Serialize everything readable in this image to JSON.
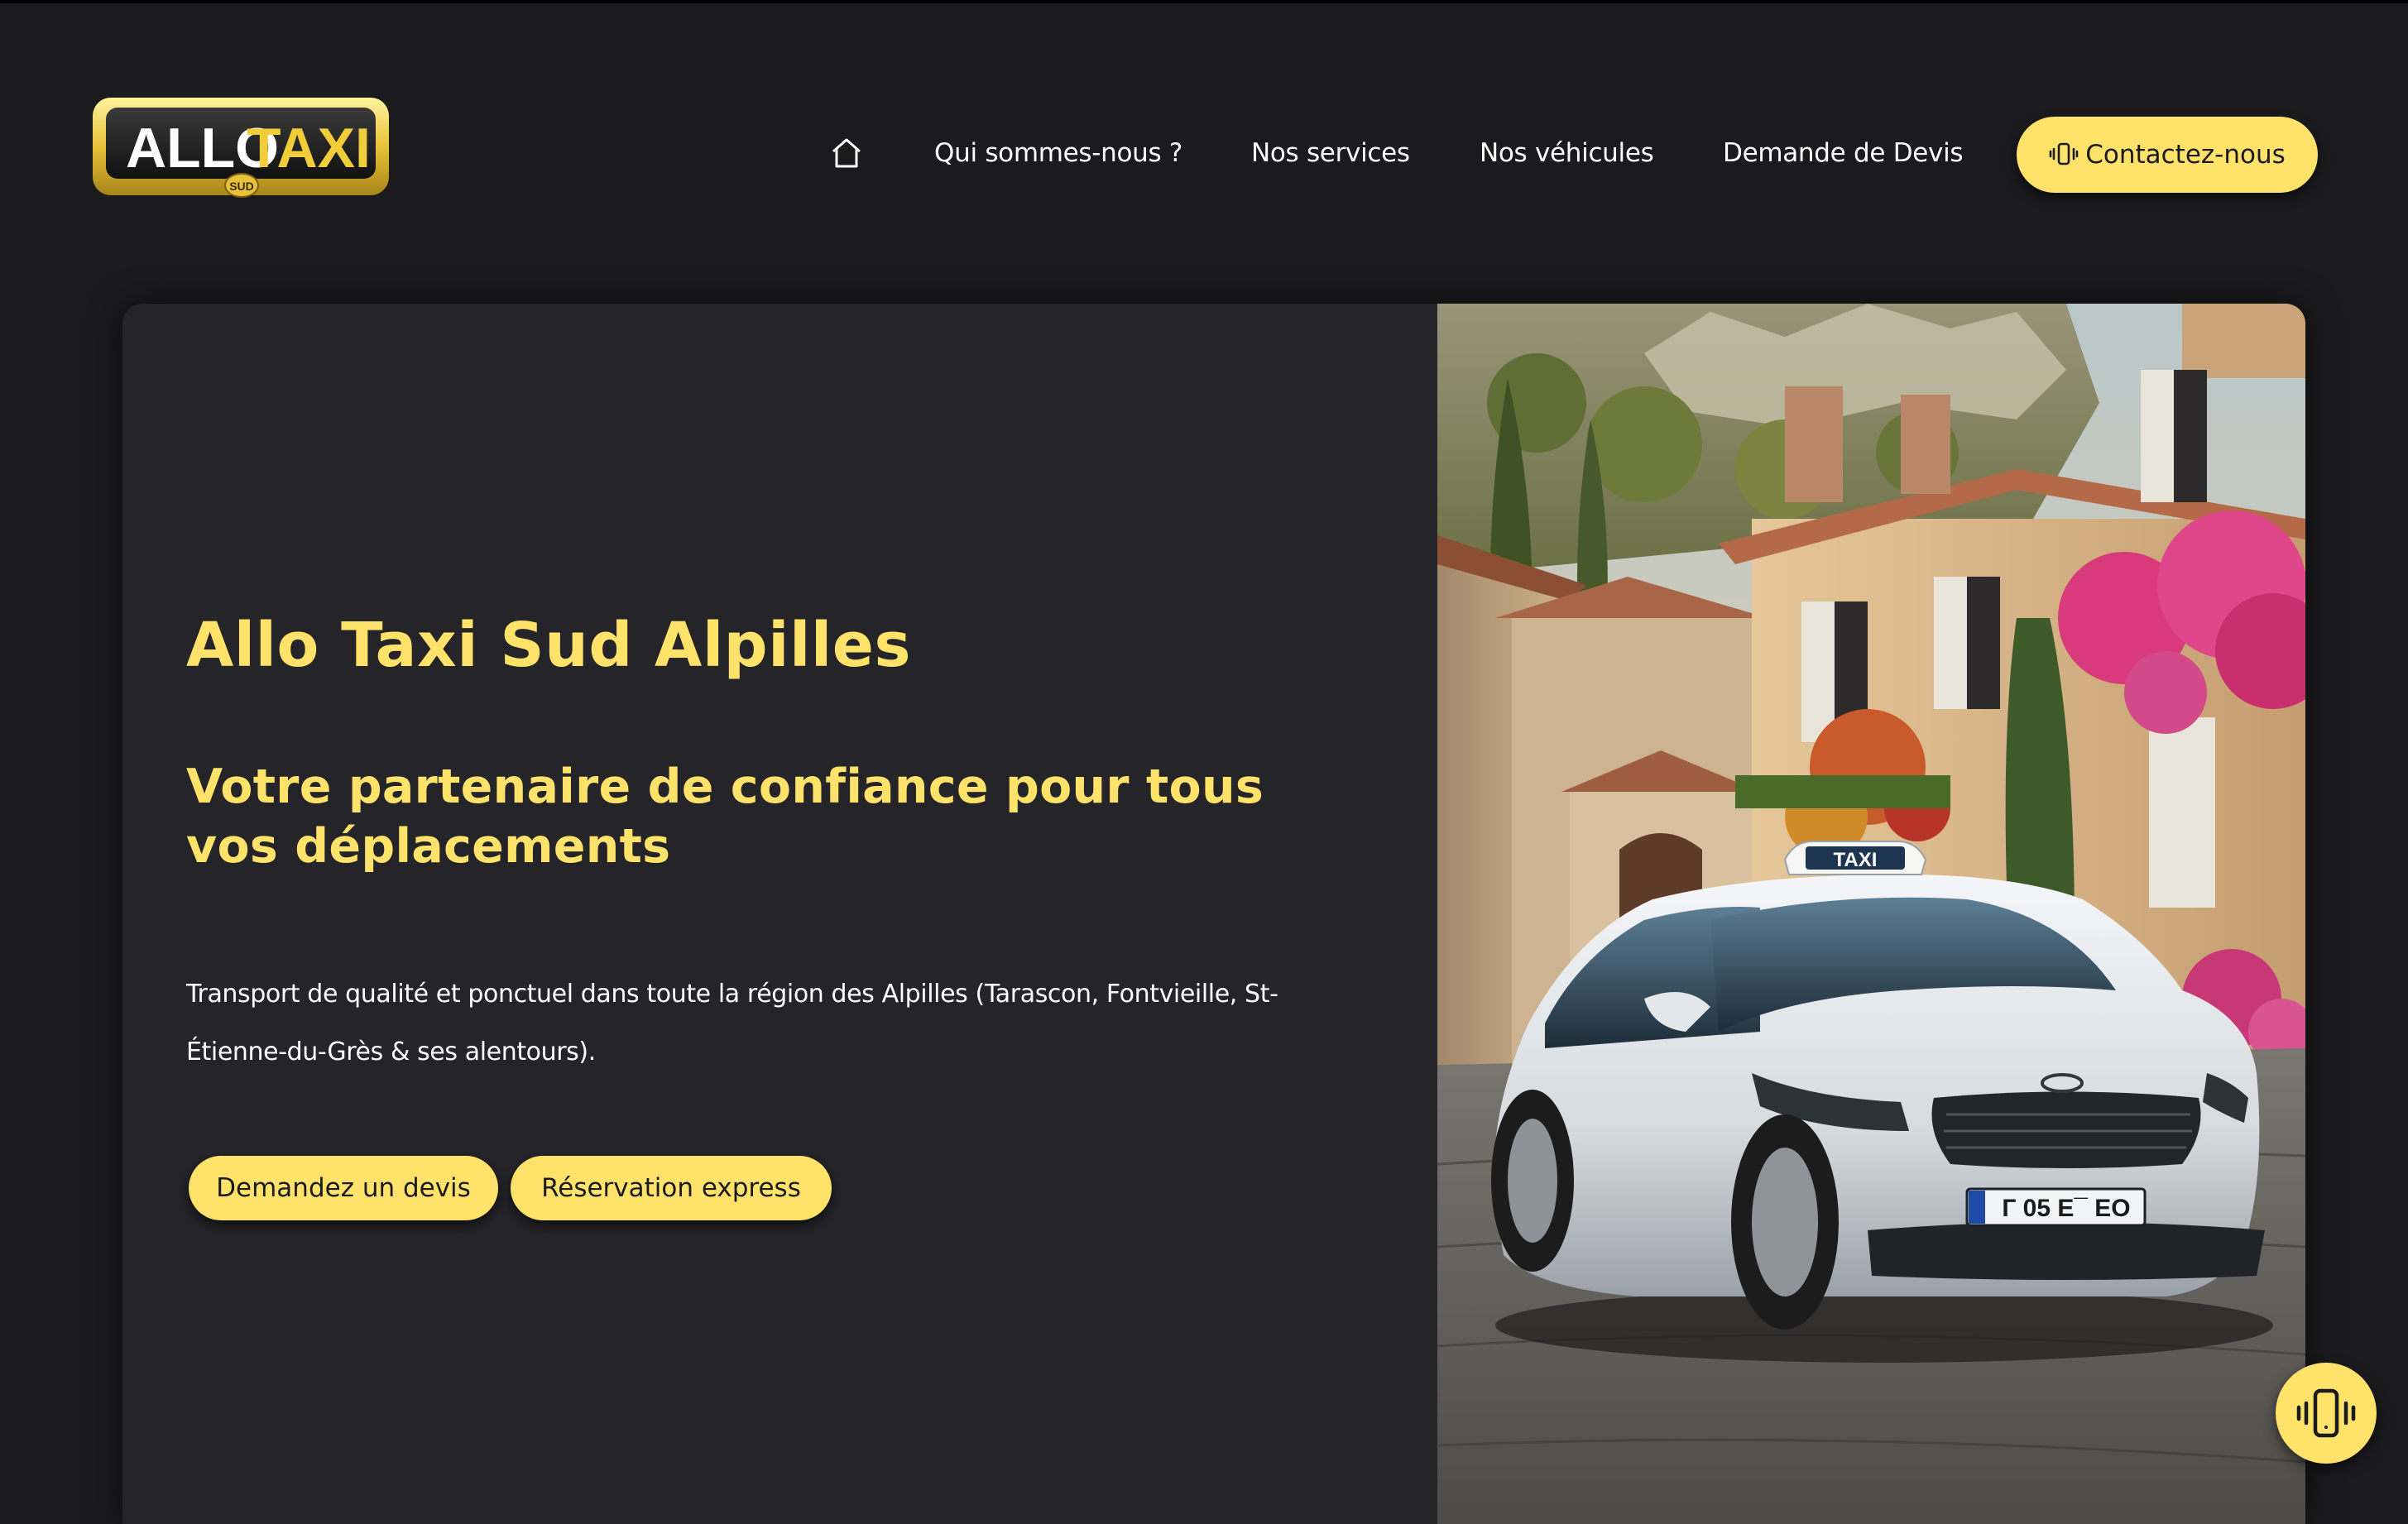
{
  "header": {
    "logo_text_left": "ALLO",
    "logo_text_right": "TAXI",
    "logo_badge": "SUD",
    "home_icon": "home-icon",
    "nav_links": [
      {
        "label": "Qui sommes-nous ?"
      },
      {
        "label": "Nos services"
      },
      {
        "label": "Nos véhicules"
      },
      {
        "label": "Demande de Devis"
      }
    ],
    "contact_button": {
      "label": "Contactez-nous",
      "icon": "phone-vibrate-icon"
    }
  },
  "hero": {
    "title": "Allo Taxi Sud Alpilles",
    "subtitle": "Votre partenaire de confiance pour tous vos déplacements",
    "description": "Transport de qualité et ponctuel dans toute la région des Alpilles (Tarascon, Fontvieille, St-Étienne-du-Grès & ses alentours).",
    "buttons": [
      {
        "label": "Demandez un devis"
      },
      {
        "label": "Réservation express"
      }
    ],
    "image": {
      "taxi_sign": "TAXI",
      "plate": "Г 05 E¯ EO"
    }
  },
  "floating_button": {
    "icon": "phone-vibrate-icon"
  },
  "colors": {
    "accent": "#ffe26a",
    "page_bg": "#1b1b1d",
    "card_bg": "#252429",
    "text_light": "#ffffff",
    "text_dark": "#1b1b1d"
  }
}
